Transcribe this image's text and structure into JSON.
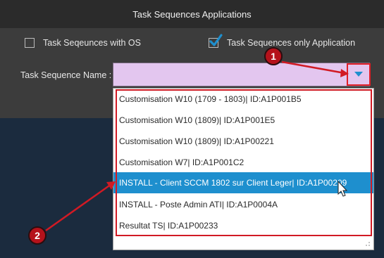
{
  "window": {
    "title": "Task Sequences Applications"
  },
  "filters": {
    "with_os": {
      "label": "Task Seqeunces with OS",
      "checked": false
    },
    "only_app": {
      "label": "Task Sequences only Application",
      "checked": true
    }
  },
  "form": {
    "name_label": "Task Sequence Name :",
    "value": ""
  },
  "dropdown": {
    "options": [
      "Customisation W10 (1709 - 1803)| ID:A1P001B5",
      "Customisation W10 (1809)| ID:A1P001E5",
      "Customisation W10 (1809)| ID:A1P00221",
      "Customisation W7| ID:A1P001C2",
      "INSTALL - Client SCCM 1802 sur Client Leger| ID:A1P00209",
      "INSTALL - Poste Admin ATI| ID:A1P0004A",
      "Resultat TS| ID:A1P00233"
    ],
    "selected_index": 4
  },
  "annotations": {
    "badge1": "1",
    "badge2": "2"
  },
  "colors": {
    "accent": "#1e8fce",
    "annotation": "#d11a24",
    "field": "#e3c6ef"
  },
  "icons": {
    "dropdown": "triangle-down-icon",
    "check": "checkmark-icon",
    "cursor": "mouse-pointer-icon"
  }
}
